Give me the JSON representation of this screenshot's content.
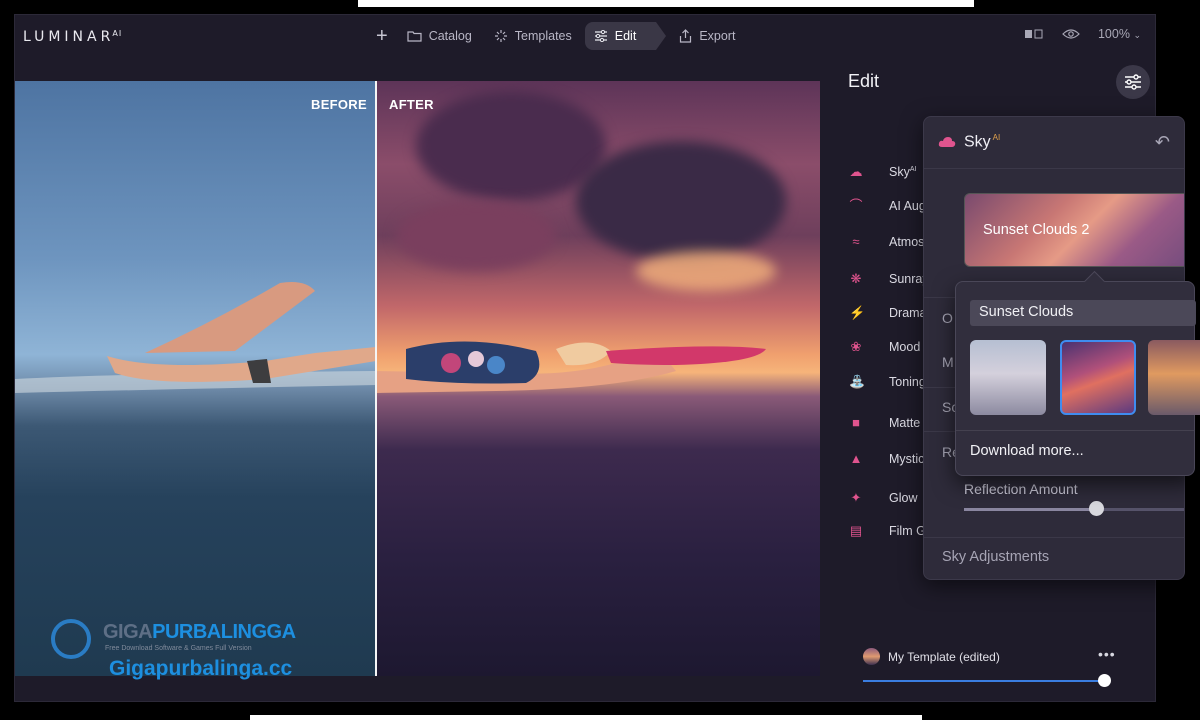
{
  "app": {
    "logo": "LUMINAR",
    "logo_sup": "AI"
  },
  "nav": {
    "items": [
      {
        "label": "Catalog",
        "icon": "folder-icon"
      },
      {
        "label": "Templates",
        "icon": "sparkle-icon"
      },
      {
        "label": "Edit",
        "icon": "sliders-icon",
        "active": true
      },
      {
        "label": "Export",
        "icon": "export-icon"
      }
    ],
    "zoom": "100%"
  },
  "photo": {
    "before_label": "BEFORE",
    "after_label": "AFTER"
  },
  "watermark": {
    "title_a": "GIGA",
    "title_b": "PURBALINGGA",
    "subtitle": "Free Download Software & Games Full Version",
    "url": "Gigapurbalinga.cc"
  },
  "panel": {
    "title": "Edit",
    "tools": [
      {
        "label": "Sky",
        "sup": "AI",
        "icon": "cloud-icon"
      },
      {
        "label": "AI Augmented Sky",
        "sup": "",
        "icon": "rainbow-icon"
      },
      {
        "label": "Atmosphere",
        "sup": "",
        "icon": "waves-icon"
      },
      {
        "label": "Sunrays",
        "sup": "",
        "icon": "sun-icon"
      },
      {
        "label": "Drama",
        "sup": "",
        "icon": "lightning-icon"
      },
      {
        "label": "Mood",
        "sup": "",
        "icon": "lotus-icon"
      },
      {
        "label": "Toning",
        "sup": "",
        "icon": "bucket-icon"
      },
      {
        "label": "Matte",
        "sup": "",
        "icon": "square-icon"
      },
      {
        "label": "Mystical",
        "sup": "",
        "icon": "cone-icon"
      },
      {
        "label": "Glow",
        "sup": "",
        "icon": "sparkle-icon"
      },
      {
        "label": "Film Grain",
        "sup": "",
        "icon": "film-icon"
      }
    ],
    "template_name": "My Template (edited)",
    "template_more": "•••",
    "template_amount": 1.0
  },
  "sky": {
    "title": "Sky",
    "title_sup": "AI",
    "selected": "Sunset Clouds 2",
    "row_stubs": [
      "O",
      "M",
      "Sc",
      "Re"
    ],
    "reflection_label": "Reflection Amount",
    "reflection_value": 0.58,
    "adjustments_label": "Sky Adjustments"
  },
  "dropdown": {
    "category": "Sunset Clouds",
    "selected_index": 1,
    "download_label": "Download more..."
  },
  "colors": {
    "accent": "#3f8cf0",
    "tool_icon": "#e0548e",
    "panel_bg": "#2e2b3a",
    "app_bg": "#1e1b29"
  }
}
